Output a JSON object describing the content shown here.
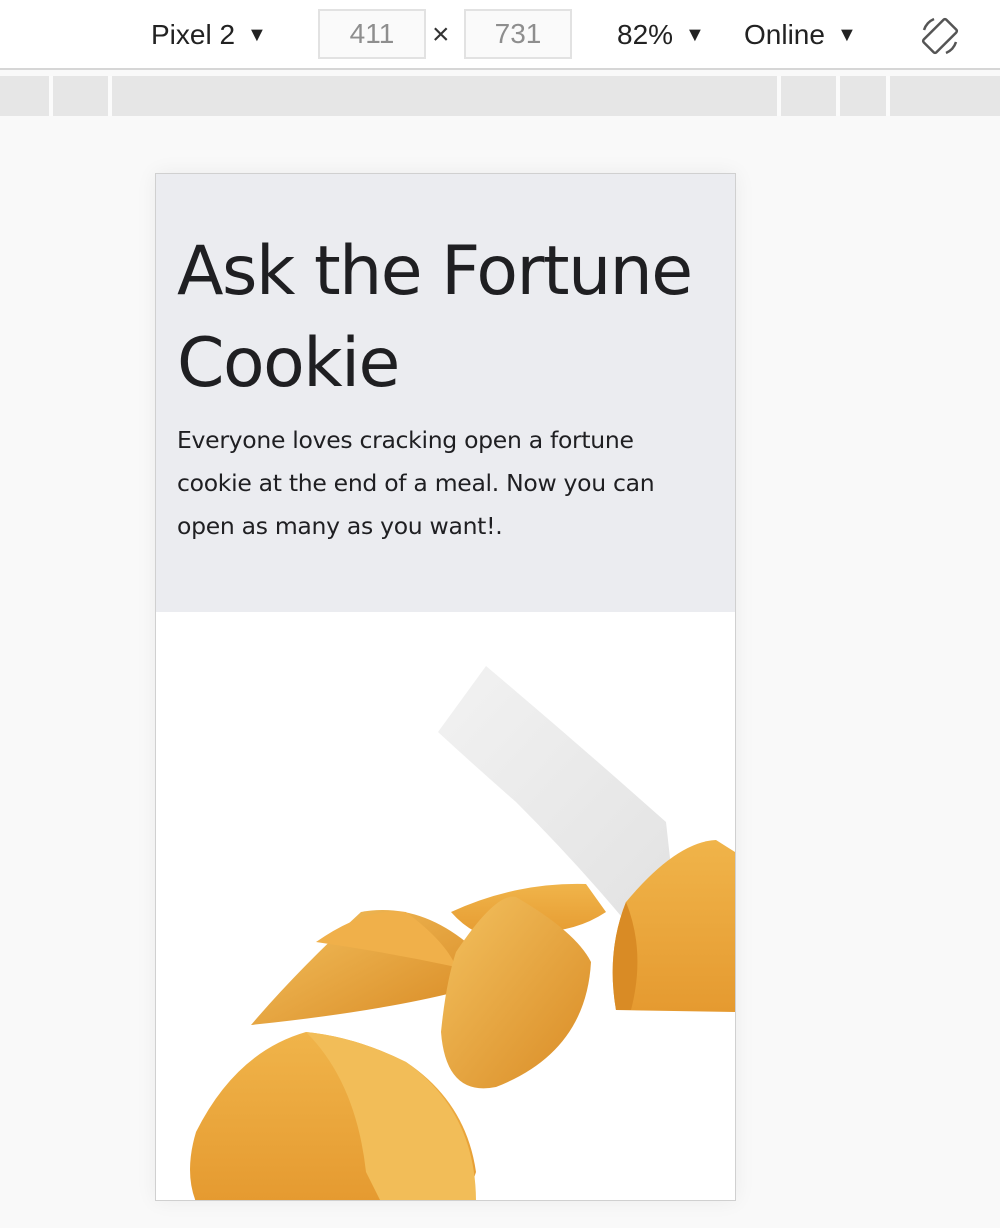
{
  "toolbar": {
    "device": "Pixel 2",
    "width": "411",
    "height": "731",
    "dimension_separator": "×",
    "zoom": "82%",
    "network": "Online",
    "caret": "▼"
  },
  "page": {
    "title": "Ask the Fortune Cookie",
    "description": "Everyone loves cracking open a fortune cookie at the end of a meal. Now you can open as many as you want!."
  },
  "icons": {
    "rotate": "rotate-icon",
    "dropdown": "caret-down-icon"
  },
  "colors": {
    "hero_background": "#ebecf0",
    "text": "#1f1f22",
    "cookie": "#e9a53a",
    "paper": "#eeeeee"
  }
}
